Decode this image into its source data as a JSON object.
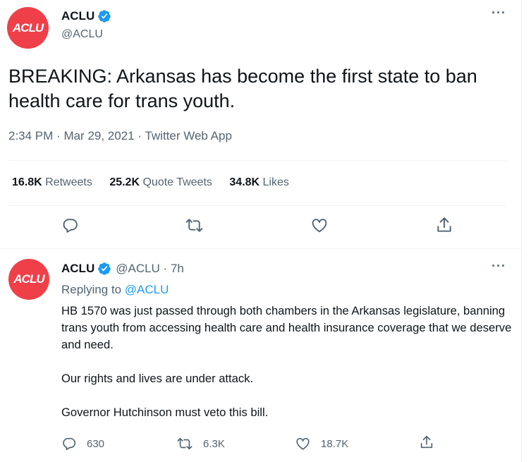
{
  "main_tweet": {
    "avatar_text": "ACLU",
    "display_name": "ACLU",
    "handle": "@ACLU",
    "text": "BREAKING: Arkansas has become the first state to ban health care for trans youth.",
    "time": "2:34 PM",
    "date": "Mar 29, 2021",
    "source": "Twitter Web App",
    "stats": {
      "retweets_count": "16.8K",
      "retweets_label": "Retweets",
      "quotes_count": "25.2K",
      "quotes_label": "Quote Tweets",
      "likes_count": "34.8K",
      "likes_label": "Likes"
    }
  },
  "reply_tweet": {
    "avatar_text": "ACLU",
    "display_name": "ACLU",
    "handle": "@ACLU",
    "age": "7h",
    "replying_prefix": "Replying to",
    "replying_to": "@ACLU",
    "paragraphs": [
      "HB 1570 was just passed through both chambers in the Arkansas legislature, banning trans youth from accessing health care and health insurance coverage that we deserve and need.",
      "Our rights and lives are under attack.",
      "Governor Hutchinson must veto this bill."
    ],
    "reply_count": "630",
    "retweet_count": "6.3K",
    "like_count": "18.7K"
  },
  "colors": {
    "brand": "#ef404a",
    "accent": "#1d9bf0",
    "muted": "#536471",
    "text": "#0f1419",
    "divider": "#eff3f4"
  },
  "icons": [
    "verified-badge-icon",
    "more-icon",
    "reply-icon",
    "retweet-icon",
    "like-icon",
    "share-icon"
  ]
}
